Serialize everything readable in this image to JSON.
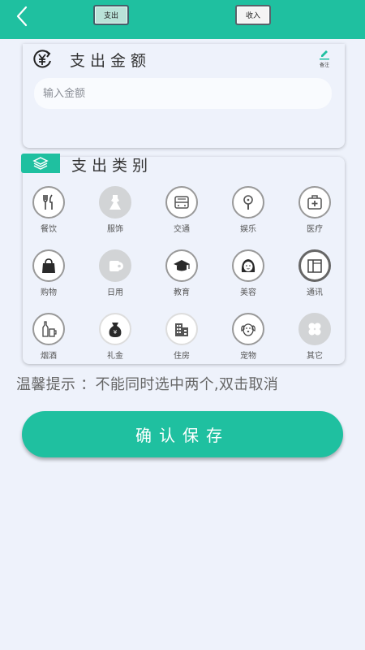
{
  "header": {
    "tabs": [
      {
        "label": "支出",
        "active": true
      },
      {
        "label": "收入",
        "active": false
      }
    ]
  },
  "amount": {
    "title": "支出金额",
    "note_label": "备注",
    "input_placeholder": "输入金额",
    "input_value": ""
  },
  "category": {
    "title": "支出类别",
    "items": [
      {
        "label": "餐饮",
        "icon": "utensils-icon"
      },
      {
        "label": "服饰",
        "icon": "dress-icon"
      },
      {
        "label": "交通",
        "icon": "bus-icon"
      },
      {
        "label": "娱乐",
        "icon": "microphone-icon"
      },
      {
        "label": "医疗",
        "icon": "medical-kit-icon"
      },
      {
        "label": "购物",
        "icon": "shopping-bag-icon"
      },
      {
        "label": "日用",
        "icon": "toilet-paper-icon"
      },
      {
        "label": "教育",
        "icon": "graduation-cap-icon"
      },
      {
        "label": "美容",
        "icon": "woman-face-icon"
      },
      {
        "label": "通讯",
        "icon": "phone-icon"
      },
      {
        "label": "烟酒",
        "icon": "beer-icon"
      },
      {
        "label": "礼金",
        "icon": "money-bag-icon"
      },
      {
        "label": "住房",
        "icon": "building-icon"
      },
      {
        "label": "宠物",
        "icon": "dog-icon"
      },
      {
        "label": "其它",
        "icon": "clover-icon"
      }
    ]
  },
  "tip": "温馨提示 ：不能同时选中两个,双击取消",
  "save_label": "确认保存",
  "colors": {
    "accent": "#1fc0a0",
    "background": "#eef2fb"
  }
}
